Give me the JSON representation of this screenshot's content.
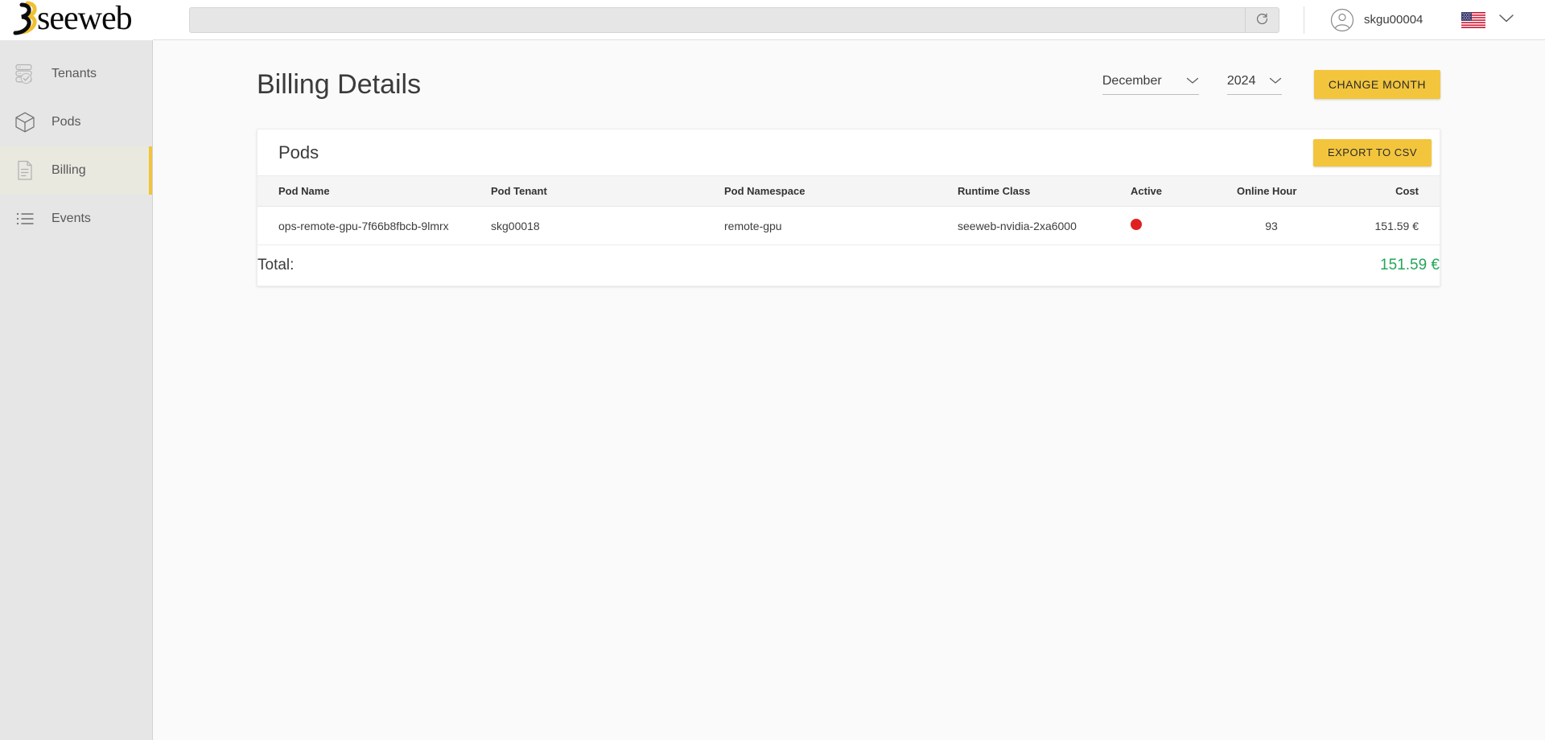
{
  "brand": {
    "name": "seeweb",
    "accent_yellow": "#f2c53d",
    "logo_mark": "seeweb-logo-mark"
  },
  "topbar": {
    "search": {
      "value": "",
      "placeholder": ""
    },
    "refresh_icon": "refresh-icon",
    "user": {
      "name": "skgu00004",
      "avatar_icon": "user-avatar-icon"
    },
    "language": {
      "flag": "us-flag-icon",
      "chevron": "chevron-down-icon"
    }
  },
  "sidebar": {
    "items": [
      {
        "label": "Tenants",
        "icon": "server-check-icon",
        "active": false
      },
      {
        "label": "Pods",
        "icon": "cube-icon",
        "active": false
      },
      {
        "label": "Billing",
        "icon": "document-icon",
        "active": true
      },
      {
        "label": "Events",
        "icon": "list-icon",
        "active": false
      }
    ]
  },
  "page": {
    "title": "Billing Details",
    "month_select": {
      "value": "December",
      "chevron": "chevron-down-icon"
    },
    "year_select": {
      "value": "2024",
      "chevron": "chevron-down-icon"
    },
    "change_month_button": "CHANGE MONTH"
  },
  "card": {
    "title": "Pods",
    "export_button": "EXPORT TO CSV",
    "columns": [
      "Pod Name",
      "Pod Tenant",
      "Pod Namespace",
      "Runtime Class",
      "Active",
      "Online Hour",
      "Cost"
    ],
    "rows": [
      {
        "pod_name": "ops-remote-gpu-7f66b8fbcb-9lmrx",
        "pod_tenant": "skg00018",
        "pod_namespace": "remote-gpu",
        "runtime_class": "seeweb-nvidia-2xa6000",
        "active_color": "#e02020",
        "online_hour": "93",
        "cost": "151.59 €"
      }
    ],
    "total_label": "Total:",
    "total_value": "151.59 €",
    "total_color": "#26a65b"
  }
}
